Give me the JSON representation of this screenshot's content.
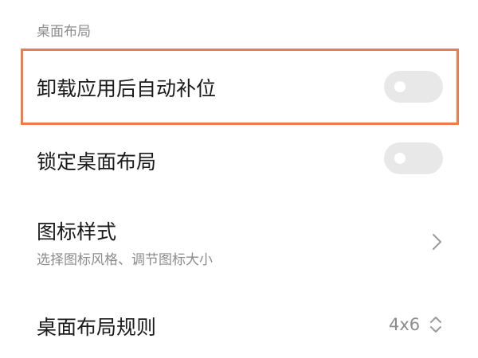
{
  "section": {
    "title": "桌面布局"
  },
  "rows": [
    {
      "title": "卸载应用后自动补位",
      "toggle_on": false,
      "highlighted": true,
      "highlight_color": "#f07a4a"
    },
    {
      "title": "锁定桌面布局",
      "toggle_on": false
    },
    {
      "title": "图标样式",
      "subtitle": "选择图标风格、调节图标大小",
      "icon": "chevron-right-icon"
    },
    {
      "title": "桌面布局规则",
      "value": "4x6",
      "icon": "chevron-up-down-icon"
    }
  ],
  "colors": {
    "toggle_off": "#e8e8e8",
    "secondary_text": "#8c8c8c",
    "primary_text": "#1a1a1a"
  }
}
